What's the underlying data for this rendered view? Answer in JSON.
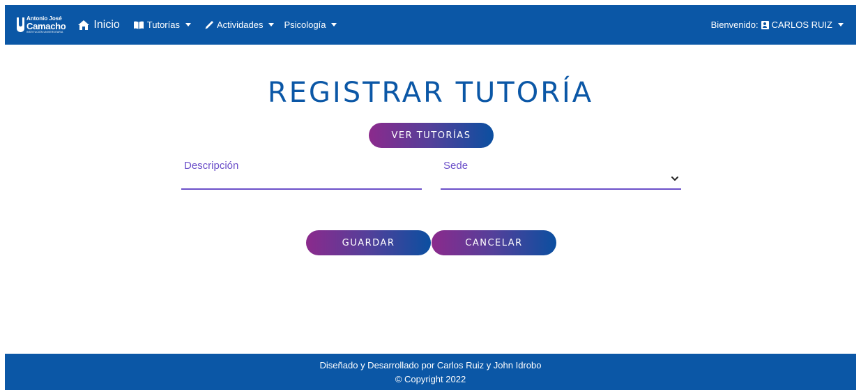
{
  "navbar": {
    "logo": {
      "line1": "Antonio José",
      "line2": "Camacho",
      "line3": "INSTITUCIÓN UNIVERSITARIA"
    },
    "home_label": "Inicio",
    "menus": [
      {
        "label": "Tutorías",
        "icon": "book-icon"
      },
      {
        "label": "Actividades",
        "icon": "pencil-icon"
      },
      {
        "label": "Psicología",
        "icon": ""
      }
    ],
    "welcome_label": "Bienvenido:",
    "user_name": "CARLOS RUIZ"
  },
  "main": {
    "title": "REGISTRAR TUTORÍA",
    "view_button": "VER TUTORÍAS",
    "form": {
      "description_label": "Descripción",
      "description_value": "",
      "sede_label": "Sede",
      "sede_value": ""
    },
    "save_button": "GUARDAR",
    "cancel_button": "CANCELAR"
  },
  "footer": {
    "credits": "Diseñado y Desarrollado por Carlos Ruiz y John Idrobo",
    "copyright": "© Copyright 2022"
  },
  "colors": {
    "primary": "#0b57a6",
    "accent": "#6b4fc9",
    "gradient_start": "#8b2a8c",
    "gradient_end": "#0b4fa0"
  }
}
